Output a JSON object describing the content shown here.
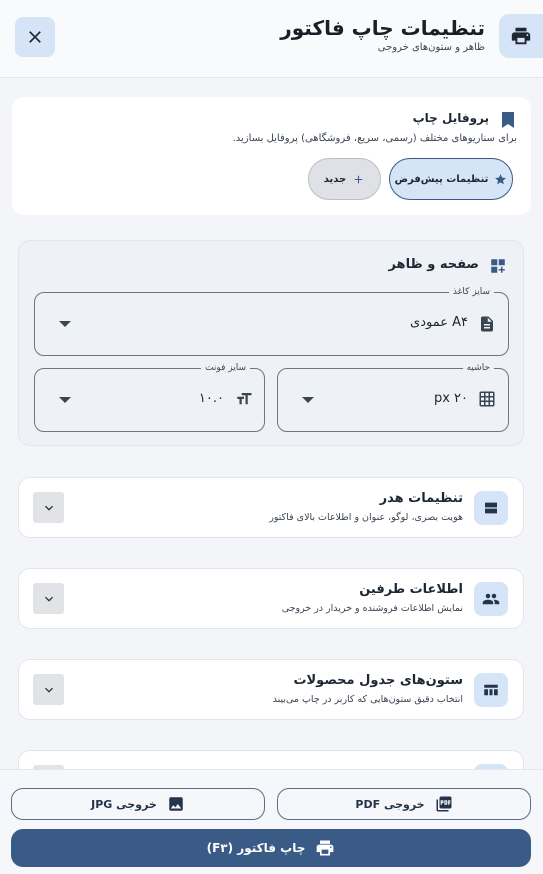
{
  "header": {
    "title": "تنظیمات چاپ فاکتور",
    "subtitle": "ظاهر و ستون‌های خروجی",
    "print_icon": "printer-icon",
    "close_icon": "close-icon"
  },
  "profile": {
    "title": "پروفایل چاپ",
    "description": "برای سناریوهای مختلف (رسمی، سریع، فروشگاهی) پروفایل بسازید.",
    "default_button": "تنظیمات پیش‌فرض",
    "new_button": "جدید"
  },
  "page_section": {
    "title": "صفحه و ظاهر",
    "paper_size": {
      "label": "سایز کاغذ",
      "value": "A۴ عمودی"
    },
    "margin": {
      "label": "حاشیه",
      "value": "px ۲۰"
    },
    "font_size": {
      "label": "سایز فونت",
      "value": "۱۰.۰"
    }
  },
  "accordions": [
    {
      "title": "تنظیمات هدر",
      "subtitle": "هویت بصری، لوگو، عنوان و اطلاعات بالای فاکتور",
      "icon": "header-layout-icon"
    },
    {
      "title": "اطلاعات طرفین",
      "subtitle": "نمایش اطلاعات فروشنده و خریدار در خروجی",
      "icon": "people-icon"
    },
    {
      "title": "ستون‌های جدول محصولات",
      "subtitle": "انتخاب دقیق ستون‌هایی که کاربر در چاپ می‌بیند",
      "icon": "table-columns-icon"
    }
  ],
  "footer": {
    "pdf_button": "خروجی PDF",
    "jpg_button": "خروجی JPG",
    "print_button": "چاپ فاکتور (F۳)"
  },
  "colors": {
    "accent": "#3a5b85",
    "accent_light": "#d6e4f7",
    "background": "#f3f5f9"
  }
}
